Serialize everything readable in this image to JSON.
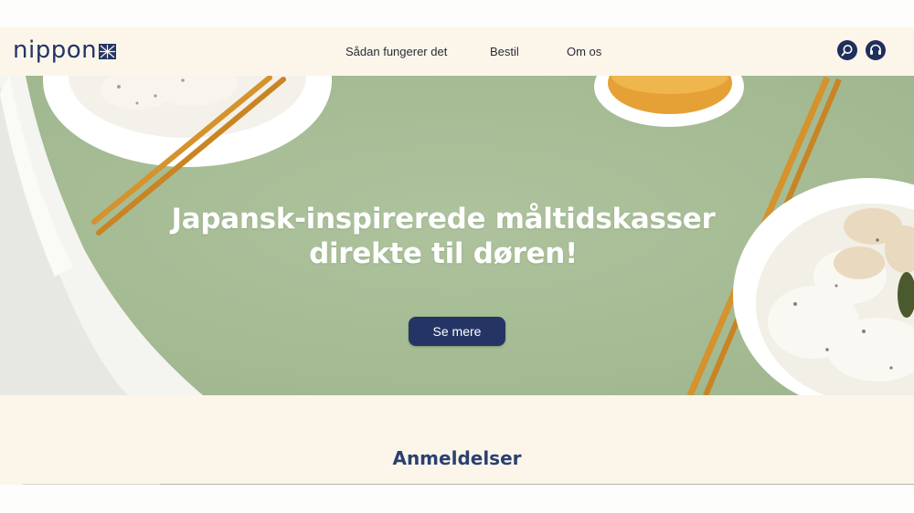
{
  "brand": {
    "logo_text": "nippon"
  },
  "nav": {
    "items": [
      {
        "label": "Sådan fungerer det"
      },
      {
        "label": "Bestil"
      },
      {
        "label": "Om os"
      }
    ]
  },
  "header_icons": {
    "search": "search-icon",
    "support": "headset-icon"
  },
  "hero": {
    "title_line1": "Japansk-inspirerede måltidskasser",
    "title_line2": "direkte til døren!",
    "cta_label": "Se mere"
  },
  "reviews": {
    "title": "Anmeldelser"
  },
  "colors": {
    "brand_navy": "#243565",
    "header_bg": "#fcf6ea",
    "hero_green": "#a8be97"
  }
}
